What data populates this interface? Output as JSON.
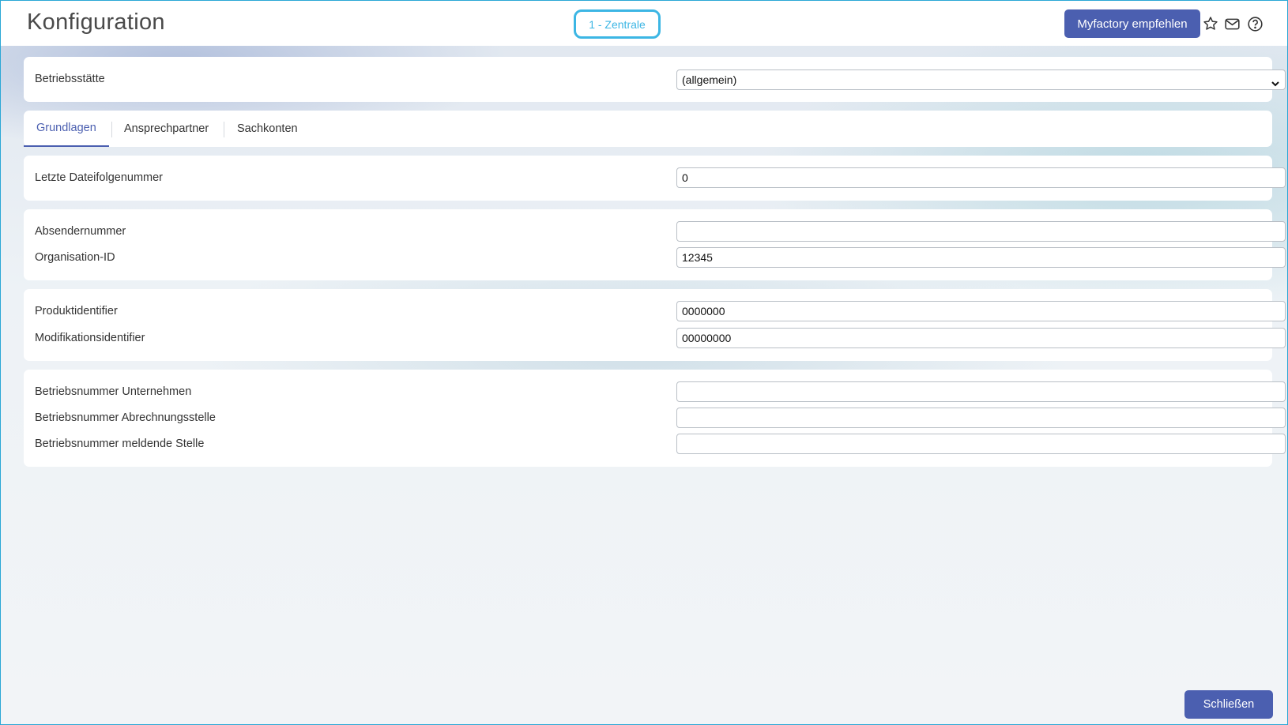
{
  "header": {
    "title": "Konfiguration",
    "site_badge": "1 - Zentrale",
    "recommend_label": "Myfactory empfehlen",
    "icons": [
      "star-icon",
      "mail-icon",
      "help-icon"
    ]
  },
  "betriebsstaette": {
    "label": "Betriebsstätte",
    "selected": "(allgemein)"
  },
  "tabs": [
    {
      "label": "Grundlagen",
      "active": true
    },
    {
      "label": "Ansprechpartner",
      "active": false
    },
    {
      "label": "Sachkonten",
      "active": false
    }
  ],
  "sections": {
    "datei": {
      "letzte_dateifolgenummer": {
        "label": "Letzte Dateifolgenummer",
        "value": "0"
      }
    },
    "absender": {
      "absendernummer": {
        "label": "Absendernummer",
        "value": ""
      },
      "organisation_id": {
        "label": "Organisation-ID",
        "value": "12345"
      }
    },
    "identifier": {
      "produktidentifier": {
        "label": "Produktidentifier",
        "value": "0000000"
      },
      "modifikationsidentifier": {
        "label": "Modifikationsidentifier",
        "value": "00000000"
      }
    },
    "betriebsnummern": {
      "unternehmen": {
        "label": "Betriebsnummer Unternehmen",
        "value": ""
      },
      "abrechnungsstelle": {
        "label": "Betriebsnummer Abrechnungsstelle",
        "value": ""
      },
      "meldende_stelle": {
        "label": "Betriebsnummer meldende Stelle",
        "value": ""
      }
    }
  },
  "footer": {
    "close_label": "Schließen"
  },
  "colors": {
    "accent": "#4b5fb0",
    "badge": "#3cb6e4",
    "frame_border": "#2aa7d6"
  }
}
